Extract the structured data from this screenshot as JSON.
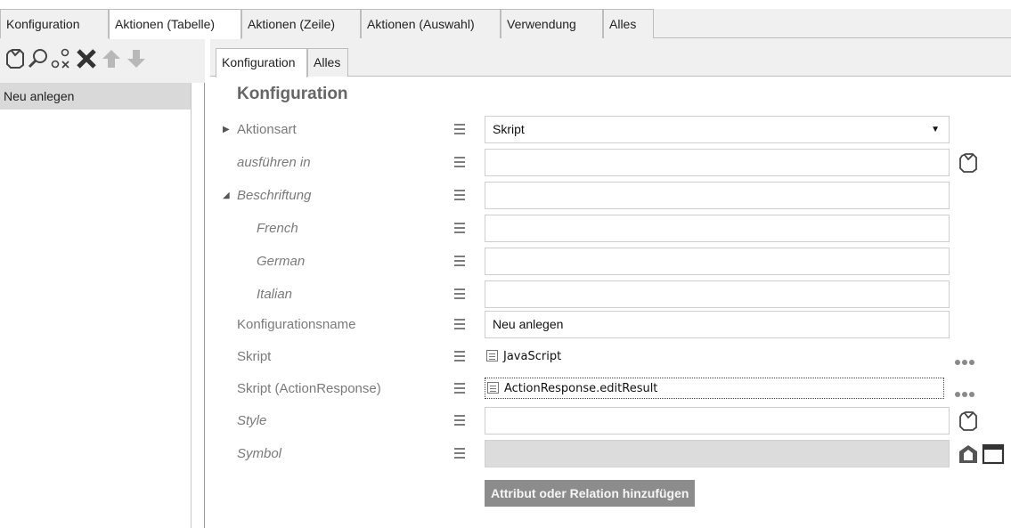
{
  "main_tabs": [
    {
      "label": "Konfiguration",
      "active": false
    },
    {
      "label": "Aktionen (Tabelle)",
      "active": true
    },
    {
      "label": "Aktionen (Zeile)",
      "active": false
    },
    {
      "label": "Aktionen (Auswahl)",
      "active": false
    },
    {
      "label": "Verwendung",
      "active": false
    },
    {
      "label": "Alles",
      "active": false
    }
  ],
  "left_toolbar": {
    "icons": [
      "new-object-icon",
      "search-icon",
      "link-unlink-icon",
      "delete-icon",
      "move-up-icon",
      "move-down-icon"
    ]
  },
  "left_list": {
    "items": [
      {
        "label": "Neu anlegen",
        "selected": true
      }
    ]
  },
  "sub_tabs": [
    {
      "label": "Konfiguration",
      "active": true
    },
    {
      "label": "Alles",
      "active": false
    }
  ],
  "form": {
    "section_title": "Konfiguration",
    "rows": [
      {
        "label": "Aktionsart",
        "value": "Skript"
      },
      {
        "label": "ausführen in",
        "value": ""
      },
      {
        "label": "Beschriftung",
        "value": ""
      },
      {
        "label": "French",
        "value": ""
      },
      {
        "label": "German",
        "value": ""
      },
      {
        "label": "Italian",
        "value": ""
      },
      {
        "label": "Konfigurationsname",
        "value": "Neu anlegen"
      },
      {
        "label": "Skript",
        "value": "JavaScript"
      },
      {
        "label": "Skript (ActionResponse)",
        "value": "ActionResponse.editResult"
      },
      {
        "label": "Style",
        "value": ""
      },
      {
        "label": "Symbol",
        "value": ""
      }
    ],
    "add_button": "Attribut oder Relation hinzufügen"
  },
  "colors": {
    "tab_bg": "#f0f0f0",
    "selected_item": "#d9d9d9",
    "label_gray": "#7a7a7a",
    "button_gray": "#8c8c8c"
  }
}
